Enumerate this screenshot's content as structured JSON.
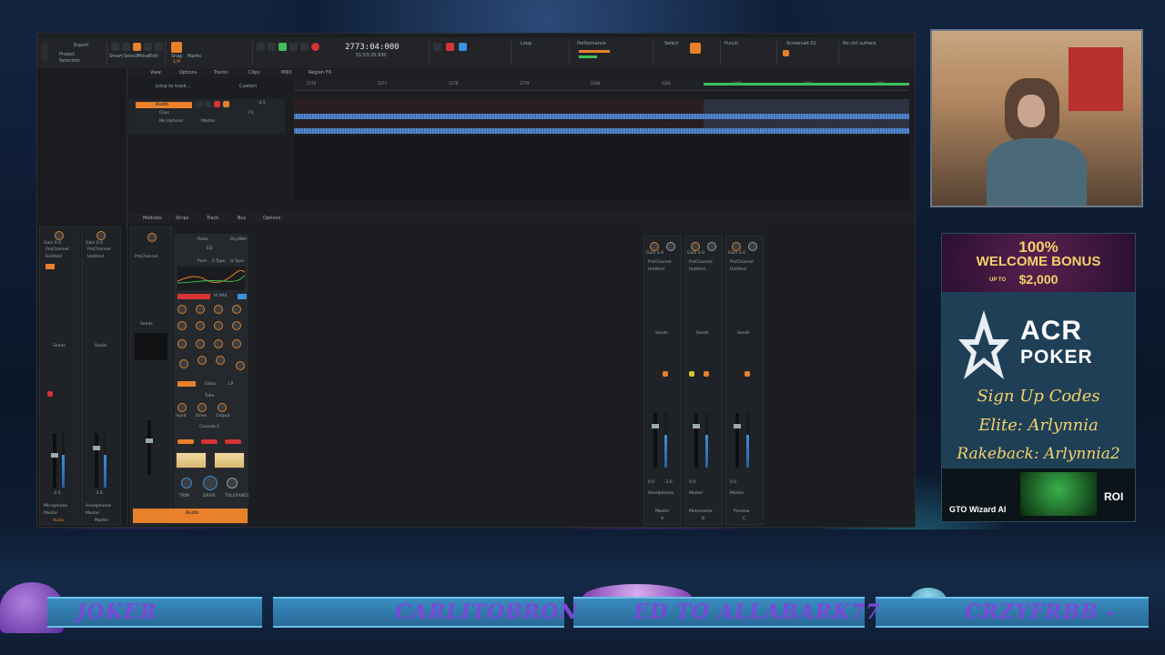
{
  "daw": {
    "menu": [
      "View",
      "Options",
      "Tracks",
      "Clips",
      "MIDI",
      "Region FX"
    ],
    "toolbar": {
      "export": "Export",
      "project_label": "Project",
      "selection_label": "Selection",
      "tools": [
        "Smart",
        "Select",
        "Move",
        "Edit",
        "Draw",
        "Erase"
      ],
      "snap": "Snap",
      "snap_value": "1/4",
      "marks": "Marks",
      "time": "2773:04:000",
      "time_sub": "01:53:25.930",
      "loop": "Loop",
      "performance": "Performance",
      "select": "Select",
      "punch": "Punch",
      "screenset": "Screenset 01",
      "control_surface": "No ctrl surface",
      "screenset_numbers": [
        "1",
        "2",
        "3",
        "4",
        "5",
        "6",
        "7",
        "8",
        "9",
        "10"
      ]
    },
    "track_nav": {
      "jump": "Jump to track...",
      "custom": "Custom"
    },
    "timeline_marks": [
      "2276",
      "2277",
      "2278",
      "2279",
      "2280",
      "2281",
      "2282",
      "2283",
      "2284"
    ],
    "track": {
      "name": "Audio",
      "clips": "Clips",
      "input": "Microphone",
      "output": "Master",
      "fx": "FX",
      "volume": "-2.5"
    },
    "lower_tabs": [
      "Modules",
      "Strips",
      "Track",
      "Bus",
      "Options"
    ],
    "left_strips": [
      {
        "gain": "Gain 0.0",
        "pan": "Pan C",
        "pc": "ProChannel",
        "preset": "Untitled",
        "sends": "Sends",
        "vol": "-2.5",
        "io": "Microphone",
        "out": "Master",
        "name": "Audio"
      },
      {
        "gain": "Gain 0.0",
        "pan": "Pan C",
        "pc": "ProChannel",
        "preset": "Untitled",
        "sends": "Sends",
        "vol": "-3.6",
        "io": "Headphones",
        "out": "Master",
        "name": "Master"
      }
    ],
    "prochannel": {
      "ratio": "Ratio",
      "dry_wet": "Dry/Wet",
      "eq": "EQ",
      "pure": "Pure",
      "etype": "E-Type",
      "gtype": "G-Type",
      "hi_mid": "Hi Mid",
      "gloss": "Gloss",
      "lp": "LP",
      "tube": "Tube",
      "console": "Console-C",
      "input": "Input",
      "drive": "Drive",
      "output": "Output",
      "trim": "TRIM",
      "drive2": "DRIVE",
      "tolerance": "TOLERANCE",
      "channel": "ProChannel",
      "sends": "Sends",
      "audio": "Audio"
    },
    "bus_strips": [
      {
        "gain": "Gain 0.0",
        "pan": "Pan C",
        "pc": "ProChannel",
        "preset": "Untitled",
        "sends": "Sends",
        "vol_l": "0.0",
        "vol_r": "-3.6",
        "out": "Headphones",
        "name": "Master",
        "letter": "A"
      },
      {
        "gain": "Gain 0.0",
        "pan": "Pan C",
        "pc": "ProChannel",
        "preset": "Untitled",
        "sends": "Sends",
        "vol_l": "0.0",
        "vol_r": "",
        "out": "Master",
        "name": "Metronome",
        "letter": "B"
      },
      {
        "gain": "Gain 0.0",
        "pan": "Pan C",
        "pc": "ProChannel",
        "preset": "Untitled",
        "sends": "Sends",
        "vol_l": "0.0",
        "vol_r": "",
        "out": "Master",
        "name": "Preview",
        "letter": "C"
      }
    ]
  },
  "ad": {
    "bonus_line1": "100%",
    "bonus_line2": "WELCOME BONUS",
    "up_to": "UP TO",
    "amount": "$2,000",
    "brand1": "ACR",
    "brand2": "POKER",
    "line1": "Sign Up Codes",
    "line2": "Elite: Arlynnia",
    "line3": "Rakeback: Arlynnia2",
    "gto_title": "GTO Wizard AI",
    "gto_roi": "ROI"
  },
  "tickers": [
    "JOKER",
    "CARLITOBRON",
    "ED TO ALLABARK77",
    "CRZYFRBB -"
  ],
  "colors": {
    "accent": "#e8812a",
    "record": "#d63434",
    "wave": "#4c7fc4"
  }
}
